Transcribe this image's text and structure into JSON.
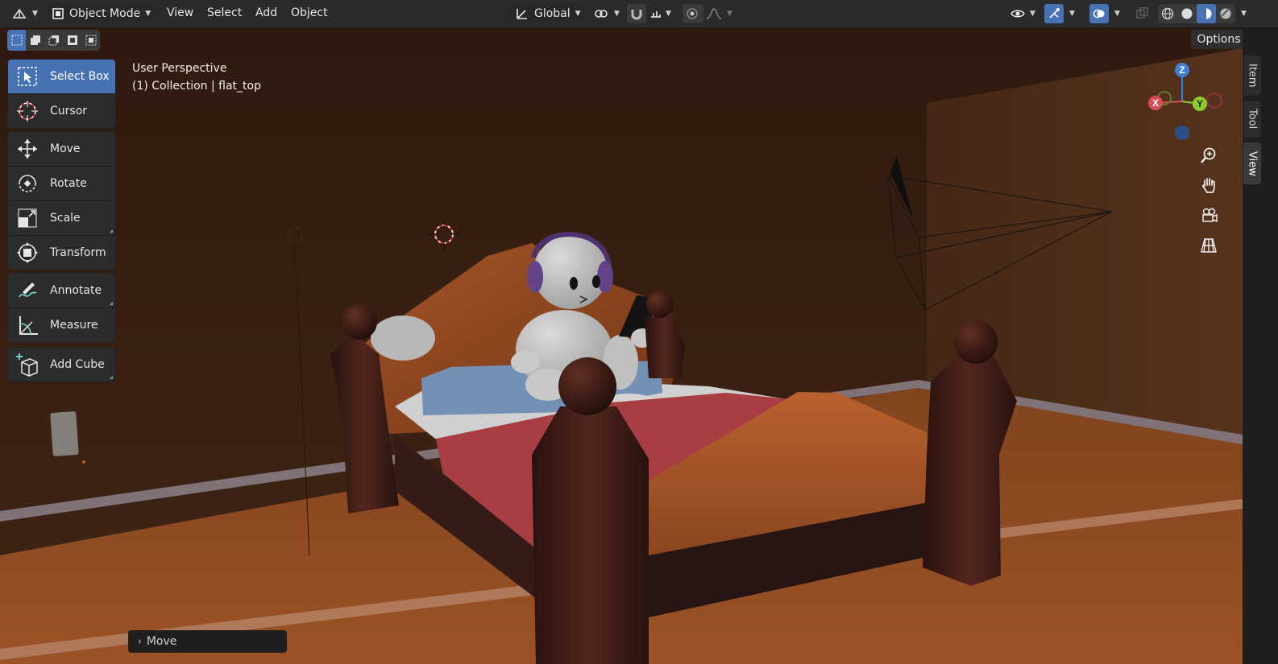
{
  "header": {
    "editor_type_icon": "3d-viewport-icon",
    "mode_label": "Object Mode",
    "menus": [
      "View",
      "Select",
      "Add",
      "Object"
    ],
    "transform_orientation": "Global"
  },
  "toolbar": {
    "groups": [
      [
        {
          "label": "Select Box",
          "icon": "select-box-icon",
          "active": true
        },
        {
          "label": "Cursor",
          "icon": "cursor-icon",
          "active": false
        }
      ],
      [
        {
          "label": "Move",
          "icon": "move-icon"
        },
        {
          "label": "Rotate",
          "icon": "rotate-icon"
        },
        {
          "label": "Scale",
          "icon": "scale-icon"
        },
        {
          "label": "Transform",
          "icon": "transform-icon"
        }
      ],
      [
        {
          "label": "Annotate",
          "icon": "annotate-icon"
        },
        {
          "label": "Measure",
          "icon": "measure-icon"
        }
      ],
      [
        {
          "label": "Add Cube",
          "icon": "add-cube-icon"
        }
      ]
    ]
  },
  "viewport": {
    "perspective": "User Perspective",
    "collection": "(1) Collection | flat_top",
    "options_label": "Options"
  },
  "gizmo": {
    "x": "X",
    "y": "Y",
    "z": "Z"
  },
  "sidebar_tabs": [
    "Item",
    "Tool",
    "View"
  ],
  "sidebar_active_tab": "View",
  "last_operator": "Move",
  "colors": {
    "accent": "#4772b3",
    "header": "#2b2b2b",
    "panel": "#2c2c2c"
  }
}
